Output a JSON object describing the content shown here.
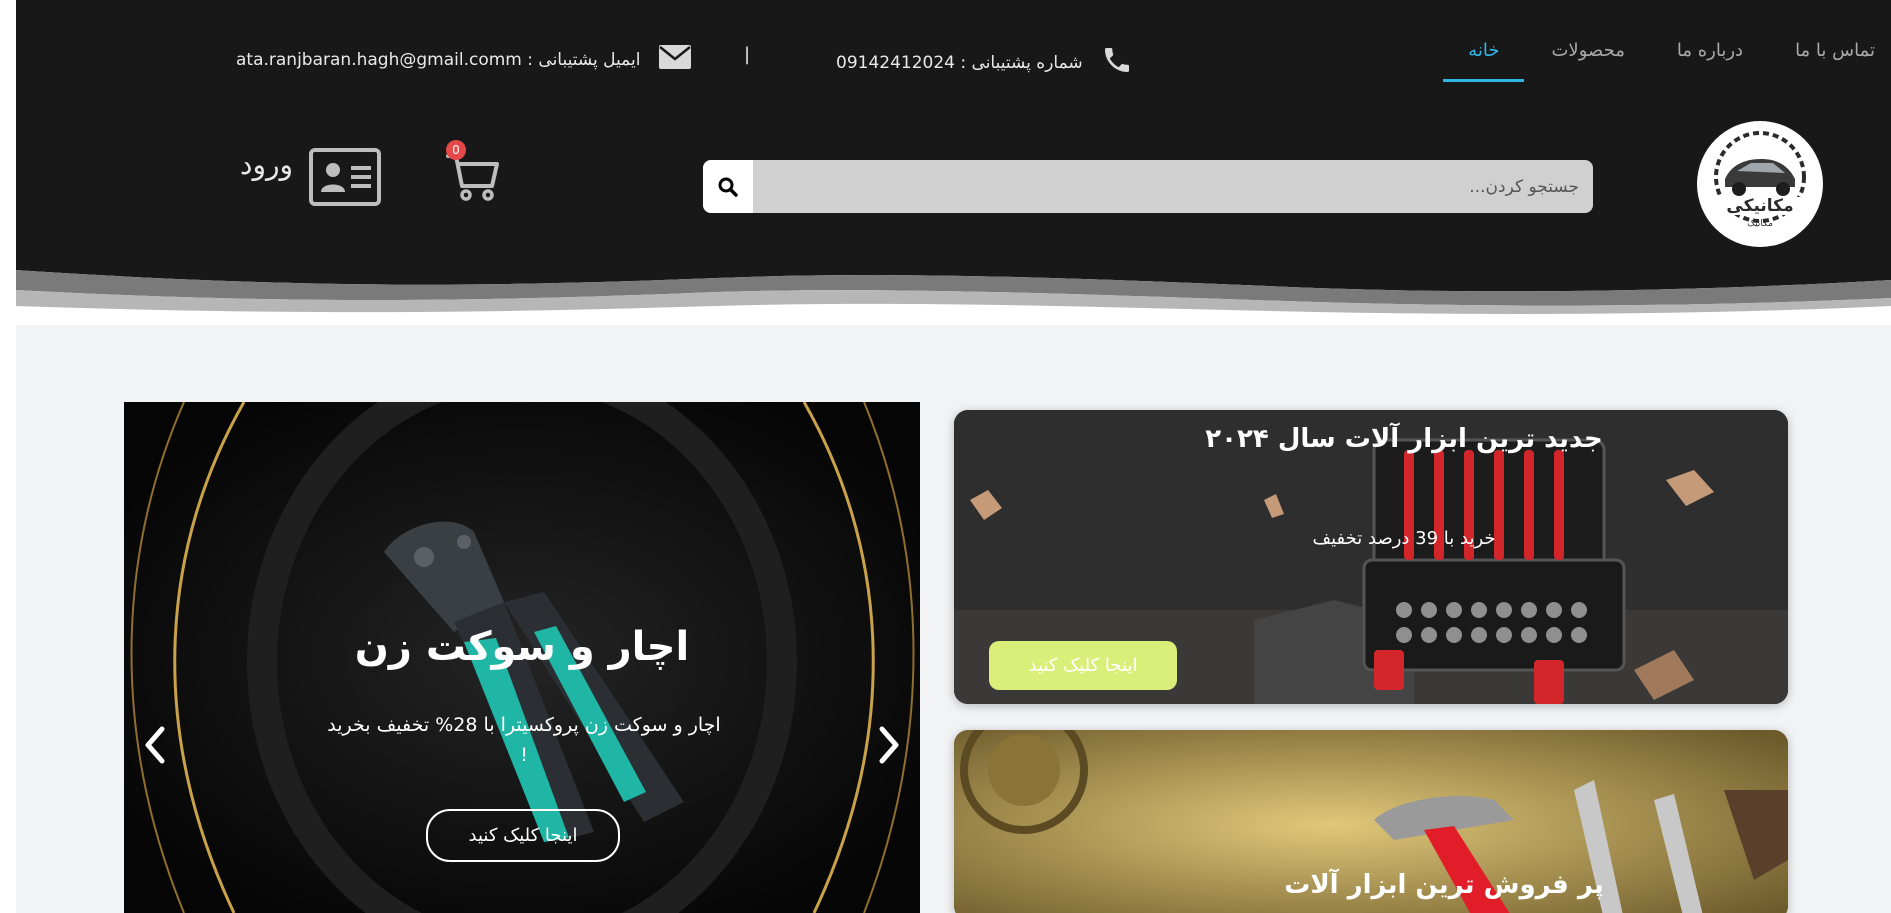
{
  "nav": {
    "home": "خانه",
    "products": "محصولات",
    "about": "درباره ما",
    "contact": "تماس با ما"
  },
  "contact": {
    "phone_label": "شماره پشتیبانی : 09142412024",
    "separator": "|",
    "email_label": "ایمیل پشتیبانی : ata.ranjbaran.hagh@gmail.comm"
  },
  "logo": {
    "text_main": "مکانیکی",
    "text_sub": "مکانیک"
  },
  "search": {
    "placeholder": "جستجو کردن..."
  },
  "cart": {
    "count": "0"
  },
  "login": {
    "label": "ورود"
  },
  "slider": {
    "title": "اچار و سوکت زن",
    "subtitle": "اچار و سوکت زن پروکسیترا با 28% تخفیف بخرید !",
    "button": "اینجا کلیک کنید"
  },
  "promo_1": {
    "title": "جدید ترین ابزار آلات سال ۲۰۲۴",
    "subtitle": "خرید با 39 درصد تخفیف",
    "button": "اینجا کلیک کنید"
  },
  "promo_2": {
    "title": "پر فروش ترین ابزار آلات"
  },
  "colors": {
    "header_bg": "#181818",
    "accent": "#30b6e6",
    "body_bg": "#f2f3f5",
    "promo_button": "#d9ef7a",
    "badge": "#e54848"
  }
}
